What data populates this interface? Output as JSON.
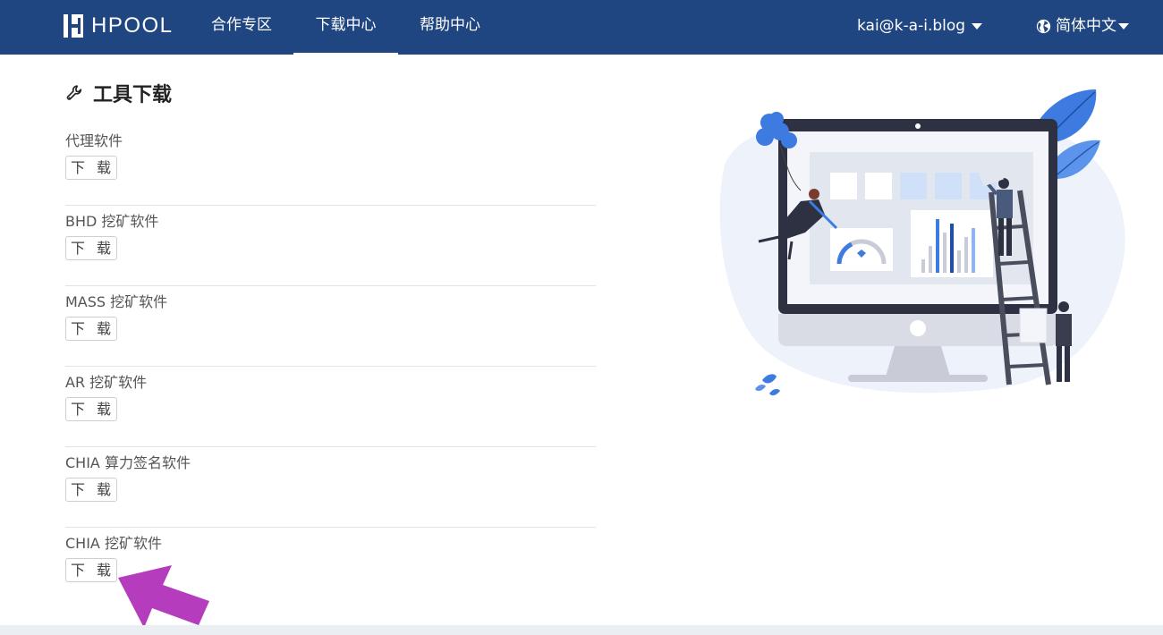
{
  "header": {
    "logo_text": "HPOOL",
    "nav": [
      {
        "label": "合作专区",
        "active": false
      },
      {
        "label": "下载中心",
        "active": true
      },
      {
        "label": "帮助中心",
        "active": false
      }
    ],
    "user_email": "kai@k-a-i.blog",
    "language": "简体中文"
  },
  "main": {
    "title": "工具下载",
    "tools": [
      {
        "name": "代理软件",
        "button": "下 载"
      },
      {
        "name": "BHD 挖矿软件",
        "button": "下 载"
      },
      {
        "name": "MASS 挖矿软件",
        "button": "下 载"
      },
      {
        "name": "AR 挖矿软件",
        "button": "下 载"
      },
      {
        "name": "CHIA 算力签名软件",
        "button": "下 载"
      },
      {
        "name": "CHIA 挖矿软件",
        "button": "下 载"
      }
    ]
  },
  "colors": {
    "navbar": "#1f4680",
    "annotation_arrow": "#b43cbd",
    "accent_blue": "#2f6fdf"
  },
  "icons": [
    "logo-icon",
    "chevron-down-icon",
    "globe-icon",
    "wrench-icon"
  ]
}
